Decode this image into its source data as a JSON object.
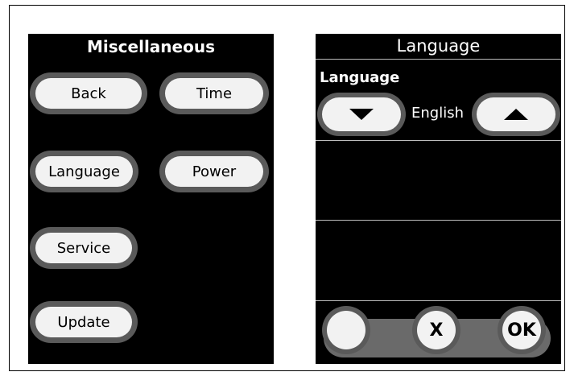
{
  "misc_panel": {
    "title": "Miscellaneous",
    "buttons": {
      "back": "Back",
      "time": "Time",
      "language": "Language",
      "power": "Power",
      "service": "Service",
      "update": "Update"
    }
  },
  "language_panel": {
    "title": "Language",
    "field_label": "Language",
    "value": "English",
    "decrease_icon": "triangle-down-icon",
    "increase_icon": "triangle-up-icon",
    "cancel_label": "X",
    "ok_label": "OK"
  },
  "colors": {
    "panel_bg": "#000000",
    "button_fill": "#f2f2f2",
    "button_rim": "#5a5a5a"
  }
}
